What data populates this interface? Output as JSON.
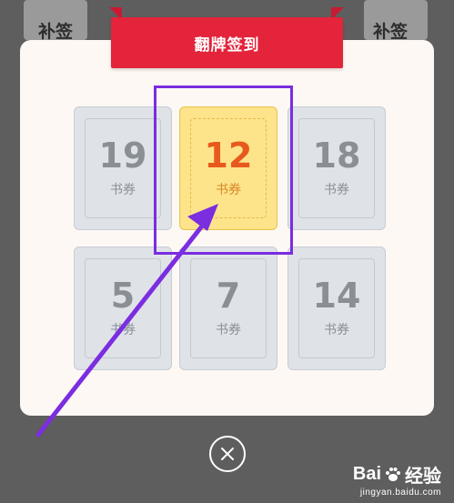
{
  "background": {
    "left_label": "补签",
    "right_label": "补签"
  },
  "modal": {
    "title": "翻牌签到"
  },
  "cards": [
    {
      "value": "19",
      "unit": "书券",
      "selected": false
    },
    {
      "value": "12",
      "unit": "书券",
      "selected": true
    },
    {
      "value": "18",
      "unit": "书券",
      "selected": false
    },
    {
      "value": "5",
      "unit": "书券",
      "selected": false
    },
    {
      "value": "7",
      "unit": "书券",
      "selected": false
    },
    {
      "value": "14",
      "unit": "书券",
      "selected": false
    }
  ],
  "close_button": {
    "icon": "close-icon"
  },
  "watermark": {
    "brand": "Bai",
    "brand_suffix": "经验",
    "url": "jingyan.baidu.com"
  },
  "colors": {
    "banner": "#e3243b",
    "highlight": "#7b2de0",
    "active_card": "#fde48a",
    "active_number": "#e8591e",
    "inactive_number": "#8a8f96"
  }
}
